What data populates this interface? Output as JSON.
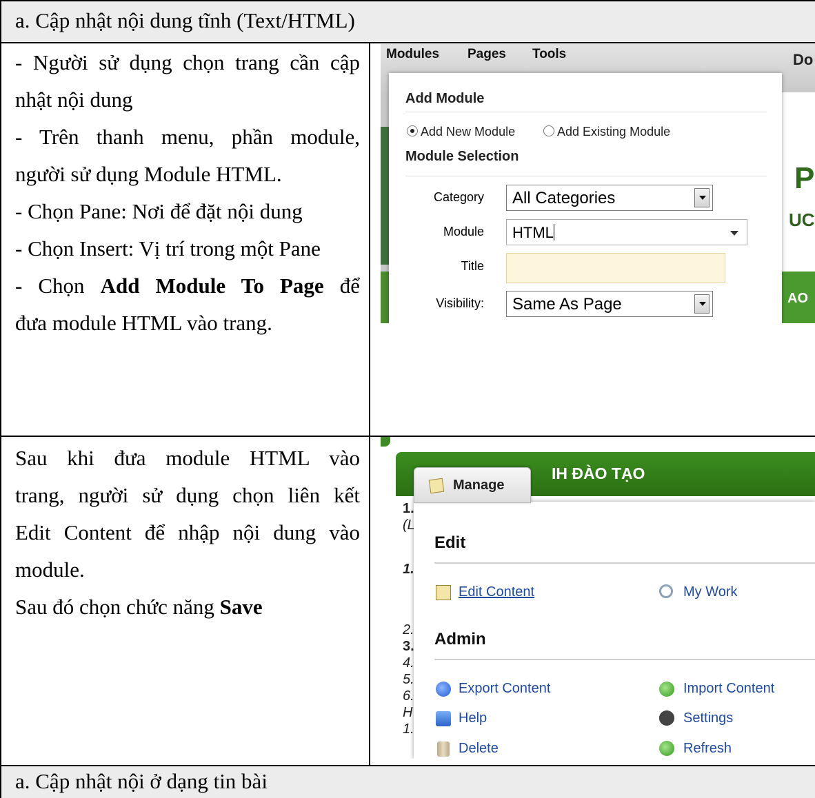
{
  "section1": {
    "header": "a. Cập nhật nội dung tĩnh (Text/HTML)",
    "lines": [
      "- Người sử dụng chọn trang cần cập",
      "nhật nội dung",
      "- Trên thanh menu, phần module,",
      "người sử dụng Module HTML.",
      "- Chọn Pane: Nơi để đặt nội dung",
      "- Chọn Insert: Vị trí trong một Pane"
    ],
    "last_prefix": "- Chọn ",
    "last_bold": "Add Module To Page",
    "last_suffix": " để",
    "last_line2": "đưa module HTML vào trang."
  },
  "shot1": {
    "menu": [
      "Modules",
      "Pages",
      "Tools"
    ],
    "menu_right": "Do",
    "panel_title": "Add Module",
    "radio_new": "Add New Module",
    "radio_existing": "Add Existing Module",
    "selection_title": "Module Selection",
    "category_label": "Category",
    "category_value": "All Categories",
    "module_label": "Module",
    "module_value": "HTML",
    "title_label": "Title",
    "title_value": "",
    "visibility_label": "Visibility:",
    "visibility_value": "Same As Page",
    "right_bg_text1": "P",
    "right_bg_text2": "UC",
    "right_bg_text3": "AO"
  },
  "section2": {
    "lines": [
      "Sau khi đưa module HTML vào",
      "trang, người sử dụng chọn liên kết",
      "Edit Content để nhập nội dung vào",
      "module."
    ],
    "save_prefix": "Sau đó chọn chức năng ",
    "save_bold": "Save"
  },
  "shot2": {
    "banner_text": "IH ĐÀO TẠO",
    "manage_label": "Manage",
    "edit_heading": "Edit",
    "edit_content": "Edit Content",
    "my_work": "My Work",
    "admin_heading": "Admin",
    "export_content": "Export Content",
    "import_content": "Import Content",
    "help": "Help",
    "settings": "Settings",
    "delete": "Delete",
    "refresh": "Refresh",
    "left_fragments": [
      "1.",
      "(L",
      "1.",
      "2.",
      "3.",
      "4.",
      "5.",
      "6.",
      "H",
      "1."
    ]
  },
  "footer": {
    "header": "a. Cập nhật nội ở dạng tin bài"
  }
}
